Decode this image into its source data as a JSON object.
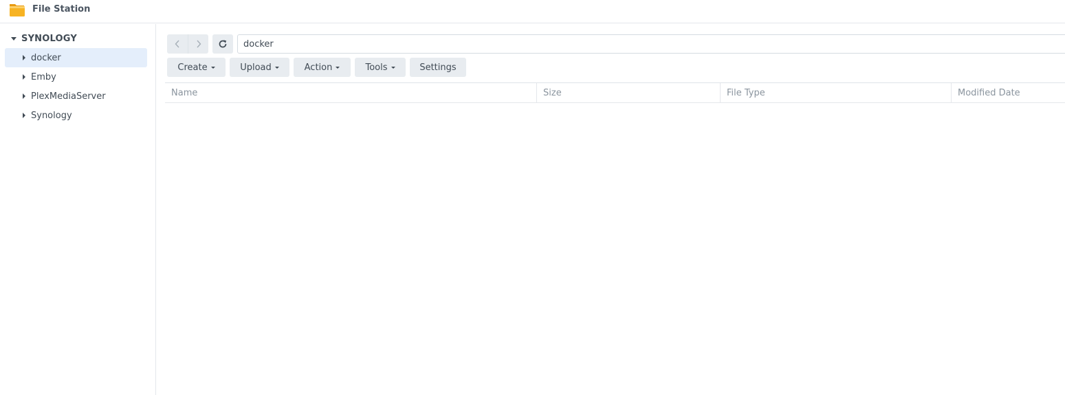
{
  "app": {
    "title": "File Station",
    "icon": "folder-icon",
    "icon_color": "#f7b323"
  },
  "sidebar": {
    "root_label": "SYNOLOGY",
    "items": [
      {
        "label": "docker",
        "selected": true
      },
      {
        "label": "Emby",
        "selected": false
      },
      {
        "label": "PlexMediaServer",
        "selected": false
      },
      {
        "label": "Synology",
        "selected": false
      }
    ]
  },
  "toolbar": {
    "path_value": "docker",
    "back_icon": "chevron-left-icon",
    "forward_icon": "chevron-right-icon",
    "refresh_icon": "refresh-icon",
    "create_label": "Create",
    "upload_label": "Upload",
    "action_label": "Action",
    "tools_label": "Tools",
    "settings_label": "Settings"
  },
  "file_list": {
    "columns": [
      "Name",
      "Size",
      "File Type",
      "Modified Date"
    ],
    "rows": []
  },
  "colors": {
    "selected_bg": "#e4eefb",
    "button_bg": "#e8ecf0",
    "header_text": "#8a949e"
  }
}
